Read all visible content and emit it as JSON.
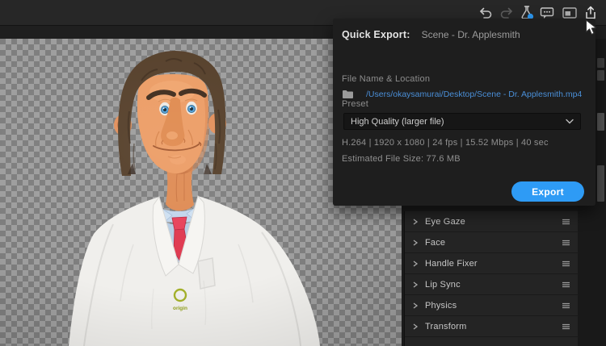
{
  "toolbar": {
    "icons": [
      {
        "name": "undo-icon"
      },
      {
        "name": "redo-icon"
      },
      {
        "name": "beaker-icon"
      },
      {
        "name": "comment-icon"
      },
      {
        "name": "picture-in-picture-icon"
      },
      {
        "name": "share-export-icon"
      }
    ]
  },
  "quick_export": {
    "title_label": "Quick Export:",
    "title_value": "Scene - Dr. Applesmith",
    "file_section_label": "File Name & Location",
    "file_path": "/Users/okaysamurai/Desktop/Scene - Dr. Applesmith.mp4",
    "preset_label": "Preset",
    "preset_value": "High Quality (larger file)",
    "format_summary": "H.264 | 1920 x 1080 | 24 fps | 15.52 Mbps | 40 sec",
    "estimated_size": "Estimated File Size: 77.6 MB",
    "export_button": "Export"
  },
  "properties_panel": {
    "rows": [
      "Eye Gaze",
      "Face",
      "Handle Fixer",
      "Lip Sync",
      "Physics",
      "Transform"
    ]
  },
  "character": {
    "badge_text": "origin"
  },
  "colors": {
    "accent_blue": "#2e9bf5",
    "link_blue": "#4a8fd8",
    "badge_green": "#9aae24",
    "panel_bg": "#1e1e1e",
    "checker_light": "#9e9e9e",
    "checker_dark": "#7e7e7e"
  }
}
